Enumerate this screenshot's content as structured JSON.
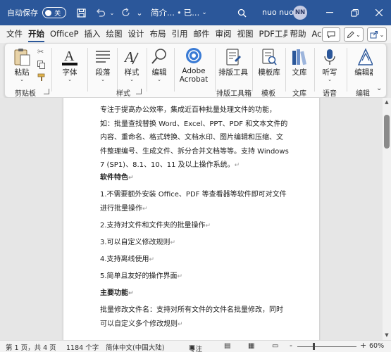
{
  "titlebar": {
    "autosave_label": "自动保存",
    "autosave_state": "关",
    "doc_title": "简介...",
    "doc_status": "已...",
    "user_name": "nuo nuo",
    "avatar_initials": "NN"
  },
  "tabs": [
    {
      "label": "文件"
    },
    {
      "label": "开始"
    },
    {
      "label": "OfficeP"
    },
    {
      "label": "插入"
    },
    {
      "label": "绘图"
    },
    {
      "label": "设计"
    },
    {
      "label": "布局"
    },
    {
      "label": "引用"
    },
    {
      "label": "邮件"
    },
    {
      "label": "审阅"
    },
    {
      "label": "视图"
    },
    {
      "label": "PDF工具"
    },
    {
      "label": "帮助"
    },
    {
      "label": "Acroba"
    }
  ],
  "ribbon": {
    "paste_label": "粘贴",
    "clipboard_group": "剪贴板",
    "font_label": "字体",
    "paragraph_label": "段落",
    "styles_label": "样式",
    "styles_group": "样式",
    "editing_label": "编辑",
    "acrobat_label_1": "Adobe",
    "acrobat_label_2": "Acrobat",
    "layout_tools_label": "排版工具",
    "layout_tools_group": "排版工具箱",
    "template_label": "模板库",
    "template_group": "模板",
    "library_label": "文库",
    "library_group": "文库",
    "dictate_label": "听写",
    "voice_group": "语音",
    "editor_label": "编辑器",
    "editor_group": "编辑"
  },
  "document": {
    "paragraphs": [
      {
        "text": "专注于提高办公效率，集成近百种批量处理文件的功能，如：批量查找替换 Word、Excel、PPT、PDF 和文本文件的内容、重命名、格式转换、文档水印、图片编辑和压缩、文件整理编号、生成文件、拆分合并文档等等。支持 Windows 7 (SP1)、8.1、10、11 及以上操作系统。",
        "bold": false
      },
      {
        "text": "软件特色",
        "bold": true
      },
      {
        "text": "1.不需要额外安装 Office、PDF 等查看器等软件即可对文件进行批量操作",
        "bold": false
      },
      {
        "text": "2.支持对文件和文件夹的批量操作",
        "bold": false
      },
      {
        "text": "3.可以自定义修改规则",
        "bold": false
      },
      {
        "text": "4.支持离线使用",
        "bold": false
      },
      {
        "text": "5.简单且友好的操作界面",
        "bold": false
      },
      {
        "text": "主要功能",
        "bold": true
      },
      {
        "text": "批量修改文件名：支持对所有文件的文件名批量修改，同时可以自定义多个修改规则",
        "bold": false
      }
    ]
  },
  "statusbar": {
    "page_info": "第 1 页，共 4 页",
    "word_count": "1184 个字",
    "language": "简体中文(中国大陆)",
    "focus": "专注",
    "zoom_minus": "-",
    "zoom_plus": "+",
    "zoom": "60%",
    "zoom_fraction": 0.6
  },
  "colors": {
    "accent": "#2b579a"
  }
}
